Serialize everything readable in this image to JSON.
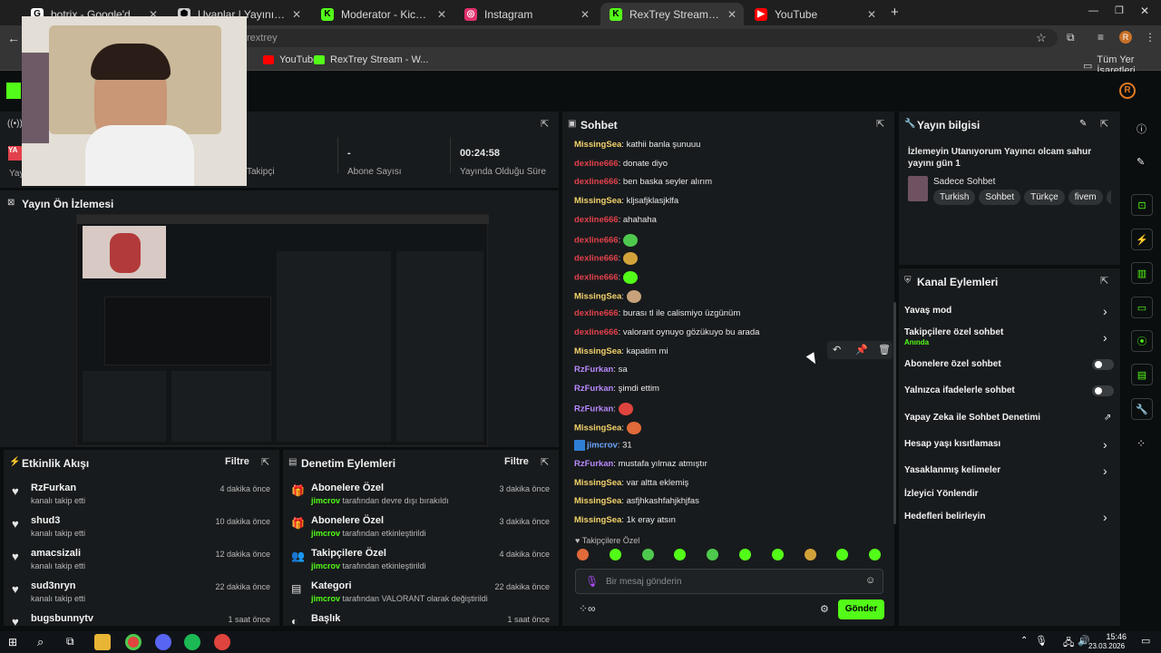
{
  "tabs": [
    {
      "label": "botrix - Google'da Ara",
      "color": "#ffffff",
      "glyph": "G"
    },
    {
      "label": "Uyanlar | Yayınını güçlendirmek",
      "color": "#cccccc",
      "glyph": "⬢"
    },
    {
      "label": "Moderator - Kick Dashboard",
      "color": "#53fc18",
      "glyph": "K"
    },
    {
      "label": "Instagram",
      "color": "#e1306c",
      "glyph": "◎"
    },
    {
      "label": "RexTrey Stream - Kick Dashboard",
      "color": "#53fc18",
      "glyph": "K"
    },
    {
      "label": "YouTube",
      "color": "#ff0000",
      "glyph": "▶"
    }
  ],
  "address": {
    "text": "rextrey"
  },
  "bookmarks": {
    "youtube": "YouTube",
    "rextrey": "RexTrey Stream - W...",
    "all": "Tüm Yer İşaretleri"
  },
  "stats": {
    "followers_label": "Takipçi",
    "sub_value": "-",
    "sub_label": "Abone Sayısı",
    "uptime_value": "00:24:58",
    "uptime_label": "Yayında Olduğu Süre",
    "left_label": "Yay"
  },
  "preview": {
    "title": "Yayın Ön İzlemesi"
  },
  "activity": {
    "title": "Etkinlik Akışı",
    "filter": "Filtre",
    "items": [
      {
        "user": "RzFurkan",
        "action": "kanalı takip etti",
        "time": "4 dakika önce"
      },
      {
        "user": "shud3",
        "action": "kanalı takip etti",
        "time": "10 dakika önce"
      },
      {
        "user": "amacsizali",
        "action": "kanalı takip etti",
        "time": "12 dakika önce"
      },
      {
        "user": "sud3nryn",
        "action": "kanalı takip etti",
        "time": "22 dakika önce"
      },
      {
        "user": "bugsbunnytv",
        "action": "",
        "time": "1 saat önce"
      }
    ]
  },
  "moderation": {
    "title": "Denetim Eylemleri",
    "filter": "Filtre",
    "items": [
      {
        "title": "Abonelere Özel",
        "actor": "jimcrov",
        "rest": "tarafından devre dışı bırakıldı",
        "time": "3 dakika önce",
        "icon": "gift-icon"
      },
      {
        "title": "Abonelere Özel",
        "actor": "jimcrov",
        "rest": "tarafından etkinleştirildi",
        "time": "3 dakika önce",
        "icon": "gift-icon"
      },
      {
        "title": "Takipçilere Özel",
        "actor": "jimcrov",
        "rest": "tarafından etkinleştirildi",
        "time": "4 dakika önce",
        "icon": "people-icon"
      },
      {
        "title": "Kategori",
        "actor": "jimcrov",
        "rest": "tarafından VALORANT olarak değiştirildi",
        "time": "22 dakika önce",
        "icon": "category-icon"
      },
      {
        "title": "Başlık",
        "actor": "",
        "rest": "",
        "time": "1 saat önce",
        "icon": "title-icon"
      }
    ]
  },
  "chat": {
    "title": "Sohbet",
    "messages": [
      {
        "user": "MissingSea",
        "cls": "u-yellow",
        "text": "kathii banla şunuuu",
        "emote": ""
      },
      {
        "user": "dexline666",
        "cls": "u-red",
        "text": "donate diyo",
        "emote": ""
      },
      {
        "user": "dexline666",
        "cls": "u-red",
        "text": "ben baska seyler alırım",
        "emote": ""
      },
      {
        "user": "MissingSea",
        "cls": "u-yellow",
        "text": "kljsafjklasjklfa",
        "emote": ""
      },
      {
        "user": "dexline666",
        "cls": "u-red",
        "text": "ahahaha",
        "emote": ""
      },
      {
        "user": "dexline666",
        "cls": "u-red",
        "text": "",
        "emote": "#4ec94e"
      },
      {
        "user": "dexline666",
        "cls": "u-red",
        "text": "",
        "emote": "#d2a23a"
      },
      {
        "user": "dexline666",
        "cls": "u-red",
        "text": "",
        "emote": "#53fc18"
      },
      {
        "user": "MissingSea",
        "cls": "u-yellow",
        "text": "",
        "emote": "#c7a27a"
      },
      {
        "user": "dexline666",
        "cls": "u-red",
        "text": "burası tl ile calismiyo üzgünüm",
        "emote": ""
      },
      {
        "user": "dexline666",
        "cls": "u-red",
        "text": "valorant oynuyo gözükuyo bu arada",
        "emote": ""
      },
      {
        "user": "MissingSea",
        "cls": "u-yellow",
        "text": "kapatim mi",
        "emote": ""
      },
      {
        "user": "RzFurkan",
        "cls": "u-purple",
        "text": "sa",
        "emote": ""
      },
      {
        "user": "RzFurkan",
        "cls": "u-purple",
        "text": "şimdi ettim",
        "emote": ""
      },
      {
        "user": "RzFurkan",
        "cls": "u-purple",
        "text": "",
        "emote": "#e0443e"
      },
      {
        "user": "MissingSea",
        "cls": "u-yellow",
        "text": "",
        "emote": "#e06a3a"
      },
      {
        "user": "jimcrov",
        "cls": "u-blue",
        "text": "31",
        "emote": ""
      },
      {
        "user": "RzFurkan",
        "cls": "u-purple",
        "text": "mustafa yılmaz atmıştır",
        "emote": ""
      },
      {
        "user": "MissingSea",
        "cls": "u-yellow",
        "text": "var altta eklemiş",
        "emote": ""
      },
      {
        "user": "MissingSea",
        "cls": "u-yellow",
        "text": "asfjhkashfahjkhjfas",
        "emote": ""
      },
      {
        "user": "MissingSea",
        "cls": "u-yellow",
        "text": "1k eray atsın",
        "emote": ""
      }
    ],
    "followers_only": "Takipçilere Özel",
    "input_placeholder": "Bir mesaj gönderin",
    "send": "Gönder",
    "emote_colors": [
      "#e06a3a",
      "#53fc18",
      "#4ec94e",
      "#53fc18",
      "#4ec94e",
      "#53fc18",
      "#53fc18",
      "#d2a23a",
      "#53fc18",
      "#53fc18"
    ]
  },
  "stream_info": {
    "title_label": "Yayın bilgisi",
    "stream_title": "İzlemeyin Utanıyorum Yayıncı olcam sahur yayını gün 1",
    "category": "Sadece Sohbet",
    "tags": [
      "Turkish",
      "Sohbet",
      "Türkçe",
      "fivem",
      "g"
    ]
  },
  "channel_actions": {
    "title": "Kanal Eylemleri",
    "slow_mode": "Yavaş mod",
    "followers_only": "Takipçilere özel sohbet",
    "followers_only_sub": "Anında",
    "subs_only": "Abonelere özel sohbet",
    "emote_only": "Yalnızca ifadelerle sohbet",
    "ai_moderation": "Yapay Zeka ile Sohbet Denetimi",
    "account_age": "Hesap yaşı kısıtlaması",
    "banned_words": "Yasaklanmış kelimeler",
    "raid": "İzleyici Yönlendir",
    "goals": "Hedefleri belirleyin"
  },
  "taskbar": {
    "time": "15:46",
    "date": "23.03.2026"
  }
}
